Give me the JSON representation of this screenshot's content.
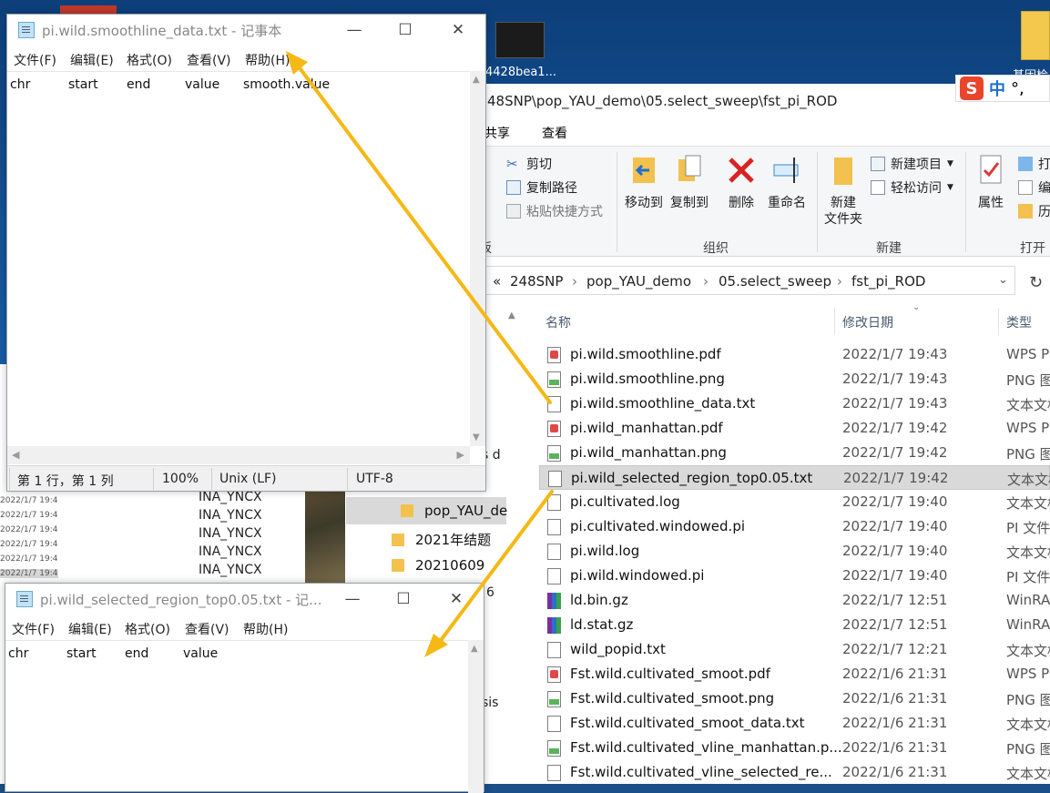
{
  "desktop": {
    "thumb_label": "4428bea1...",
    "folder_label": "基因检"
  },
  "ime": {
    "zh": "中",
    "punct": "°,"
  },
  "explorer": {
    "path_title": "48SNP\\pop_YAU_demo\\05.select_sweep\\fst_pi_ROD",
    "tabs": [
      "共享",
      "查看"
    ],
    "clipboard": {
      "cut": "剪切",
      "copy_path": "复制路径",
      "paste_shortcut": "粘贴快捷方式",
      "paste_frag": "贴",
      "group_frag": "板"
    },
    "organize": {
      "move_to": "移动到",
      "copy_to": "复制到",
      "delete": "删除",
      "rename": "重命名",
      "group": "组织"
    },
    "new": {
      "new_folder_1": "新建",
      "new_folder_2": "文件夹",
      "new_item": "新建项目",
      "easy_access": "轻松访问",
      "group": "新建"
    },
    "open": {
      "properties": "属性",
      "open_frag": "打",
      "edit_frag": "编",
      "history_frag": "历",
      "group": "打开"
    },
    "breadcrumb": [
      "«",
      "248SNP",
      "pop_YAU_demo",
      "05.select_sweep",
      "fst_pi_ROD"
    ],
    "columns": {
      "name": "名称",
      "date": "修改日期",
      "type": "类型"
    },
    "files": [
      {
        "name": "pi.wild.smoothline.pdf",
        "date": "2022/1/7 19:43",
        "type": "WPS PI",
        "icon": "pdf-icon"
      },
      {
        "name": "pi.wild.smoothline.png",
        "date": "2022/1/7 19:43",
        "type": "PNG 图",
        "icon": "png-icon"
      },
      {
        "name": "pi.wild.smoothline_data.txt",
        "date": "2022/1/7 19:43",
        "type": "文本文档",
        "icon": "txt-icon"
      },
      {
        "name": "pi.wild_manhattan.pdf",
        "date": "2022/1/7 19:42",
        "type": "WPS PI",
        "icon": "pdf-icon"
      },
      {
        "name": "pi.wild_manhattan.png",
        "date": "2022/1/7 19:42",
        "type": "PNG 图",
        "icon": "png-icon"
      },
      {
        "name": "pi.wild_selected_region_top0.05.txt",
        "date": "2022/1/7 19:42",
        "type": "文本文档",
        "icon": "txt-icon"
      },
      {
        "name": "pi.cultivated.log",
        "date": "2022/1/7 19:40",
        "type": "文本文档",
        "icon": "txt-icon"
      },
      {
        "name": "pi.cultivated.windowed.pi",
        "date": "2022/1/7 19:40",
        "type": "PI 文件",
        "icon": "file-icon"
      },
      {
        "name": "pi.wild.log",
        "date": "2022/1/7 19:40",
        "type": "文本文档",
        "icon": "txt-icon"
      },
      {
        "name": "pi.wild.windowed.pi",
        "date": "2022/1/7 19:40",
        "type": "PI 文件",
        "icon": "file-icon"
      },
      {
        "name": "ld.bin.gz",
        "date": "2022/1/7 12:51",
        "type": "WinRA",
        "icon": "rar-icon"
      },
      {
        "name": "ld.stat.gz",
        "date": "2022/1/7 12:51",
        "type": "WinRA",
        "icon": "rar-icon"
      },
      {
        "name": "wild_popid.txt",
        "date": "2022/1/7 12:21",
        "type": "文本文档",
        "icon": "txt-icon"
      },
      {
        "name": "Fst.wild.cultivated_smoot.pdf",
        "date": "2022/1/6 21:31",
        "type": "WPS PI",
        "icon": "pdf-icon"
      },
      {
        "name": "Fst.wild.cultivated_smoot.png",
        "date": "2022/1/6 21:31",
        "type": "PNG 图",
        "icon": "png-icon"
      },
      {
        "name": "Fst.wild.cultivated_smoot_data.txt",
        "date": "2022/1/6 21:31",
        "type": "文本文档",
        "icon": "txt-icon"
      },
      {
        "name": "Fst.wild.cultivated_vline_manhattan.p...",
        "date": "2022/1/6 21:31",
        "type": "PNG 图",
        "icon": "png-icon"
      },
      {
        "name": "Fst.wild.cultivated_vline_selected_re...",
        "date": "2022/1/6 21:31",
        "type": "文本文档",
        "icon": "txt-icon"
      }
    ],
    "selected_index": 5
  },
  "background": {
    "dates": [
      "2022/1/7 19:4",
      "2022/1/7 19:4",
      "2022/1/7 19:4",
      "2022/1/7 19:4",
      "2022/1/7 19:4",
      "2022/1/7 19:4"
    ],
    "ynx": [
      "INA_YNCX",
      "INA_YNCX",
      "INA_YNCX",
      "INA_YNCX",
      "INA_YNCX"
    ],
    "nav": [
      "pop_YAU_de",
      "2021年结题",
      "20210609"
    ],
    "frag_s_d": "s d",
    "frag_6": "6",
    "frag_sis": "sis"
  },
  "notepad1": {
    "title": "pi.wild.smoothline_data.txt - 记事本",
    "menu": [
      "文件(F)",
      "编辑(E)",
      "格式(O)",
      "查看(V)",
      "帮助(H)"
    ],
    "content": [
      "chr",
      "start",
      "end",
      "value",
      "smooth.value"
    ],
    "status": {
      "position": "第 1 行，第 1 列",
      "zoom": "100%",
      "eol": "Unix (LF)",
      "encoding": "UTF-8"
    }
  },
  "notepad2": {
    "title": "pi.wild_selected_region_top0.05.txt - 记...",
    "menu": [
      "文件(F)",
      "编辑(E)",
      "格式(O)",
      "查看(V)",
      "帮助(H)"
    ],
    "content": [
      "chr",
      "start",
      "end",
      "value"
    ]
  },
  "colors": {
    "arrow": "#f5b815",
    "selected_row": "#d9d9d9"
  }
}
